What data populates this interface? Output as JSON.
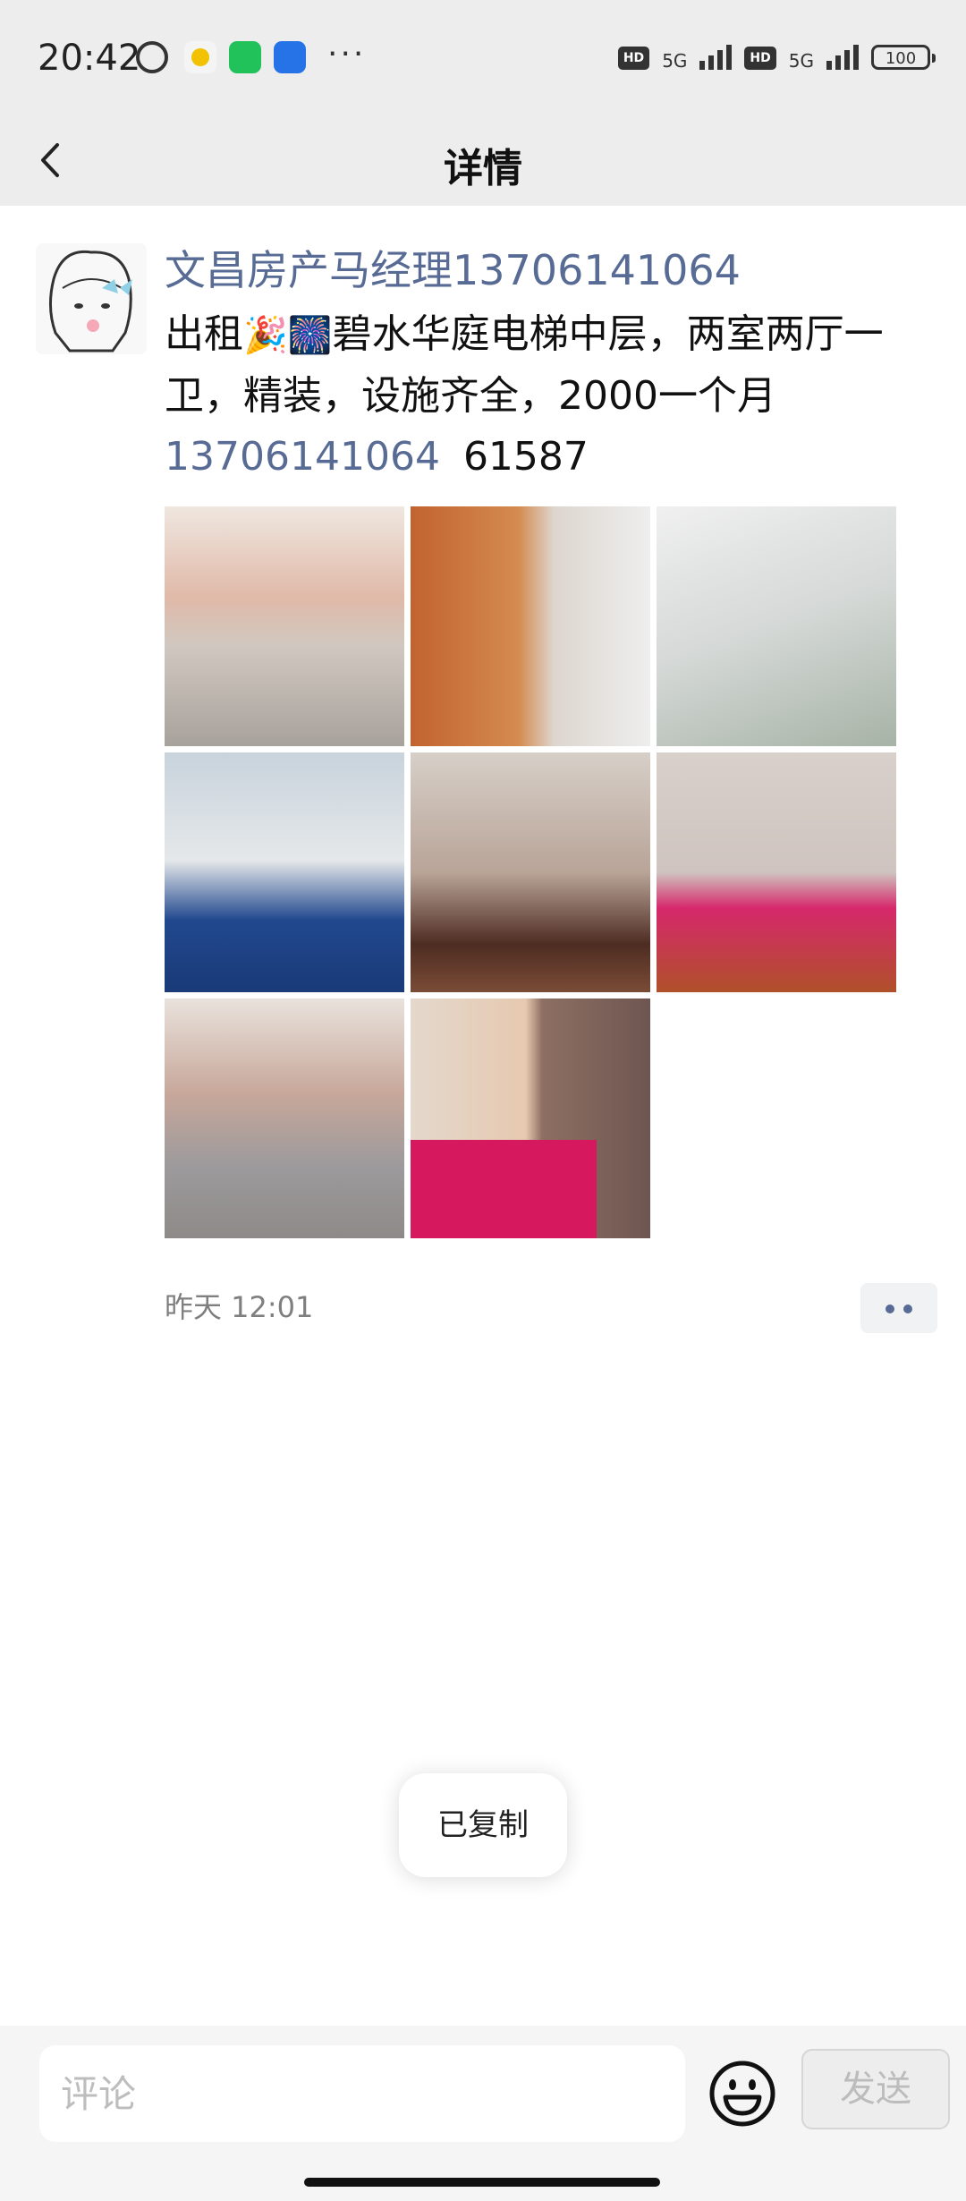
{
  "status_bar": {
    "time": "20:42",
    "hd1": "HD",
    "net1": "5G",
    "hd2": "HD",
    "net2": "5G",
    "battery": "100"
  },
  "nav": {
    "title": "详情"
  },
  "post": {
    "author": "文昌房产马经理13706141064",
    "text_before": "出租",
    "emojis": "🎉🎆",
    "text_after": "碧水华庭电梯中层，两室两厅一卫，精装，设施齐全，2000一个月",
    "phone": "13706141064",
    "code": "61587",
    "photo_count": 8,
    "time": "昨天 12:01"
  },
  "toast": {
    "text": "已复制"
  },
  "comment_bar": {
    "placeholder": "评论",
    "send_label": "发送"
  },
  "colors": {
    "link": "#576b95",
    "bar_bg": "#ededed"
  }
}
